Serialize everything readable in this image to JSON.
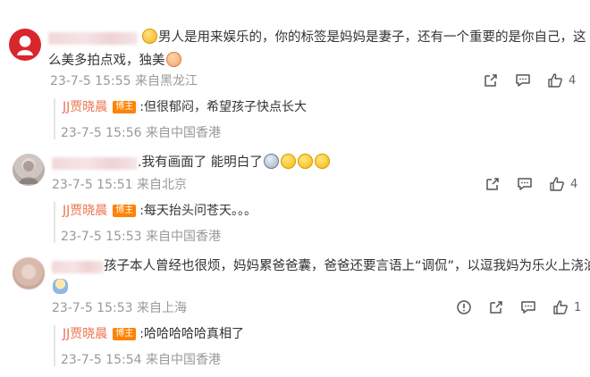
{
  "comments": [
    {
      "text_line1_suffix": "男人是用来娱乐的，你的标签是妈妈是妻子，还有一个重要的是你自己，这",
      "text_line2": "么美多拍点戏，独美",
      "time": "23-7-5 15:55",
      "location": "来自黑龙江",
      "likes": "4",
      "reply": {
        "author": "JJ贾晓晨",
        "badge": "博主",
        "text": ":但很郁闷，希望孩子快点长大",
        "time": "23-7-5 15:56",
        "location": "来自中国香港"
      }
    },
    {
      "text": ".我有画面了 能明白了",
      "time": "23-7-5 15:51",
      "location": "来自北京",
      "likes": "4",
      "reply": {
        "author": "JJ贾晓晨",
        "badge": "博主",
        "text": ":每天抬头问苍天。。。",
        "time": "23-7-5 15:53",
        "location": "来自中国香港"
      }
    },
    {
      "text": "孩子本人曾经也很烦，妈妈累爸爸囊，爸爸还要言语上“调侃”，以逗我妈为乐火上浇油",
      "time": "23-7-5 15:53",
      "location": "来自上海",
      "likes": "1",
      "reply": {
        "author": "JJ贾晓晨",
        "badge": "博主",
        "text": ":哈哈哈哈哈真相了",
        "time": "23-7-5 15:54",
        "location": "来自中国香港"
      }
    }
  ],
  "icons": {
    "share": "share-icon",
    "comment": "comment-icon",
    "like": "thumbs-up-icon",
    "report": "report-icon"
  },
  "colors": {
    "author": "#eb7350",
    "badge": "#ff8200",
    "meta": "#999999"
  }
}
